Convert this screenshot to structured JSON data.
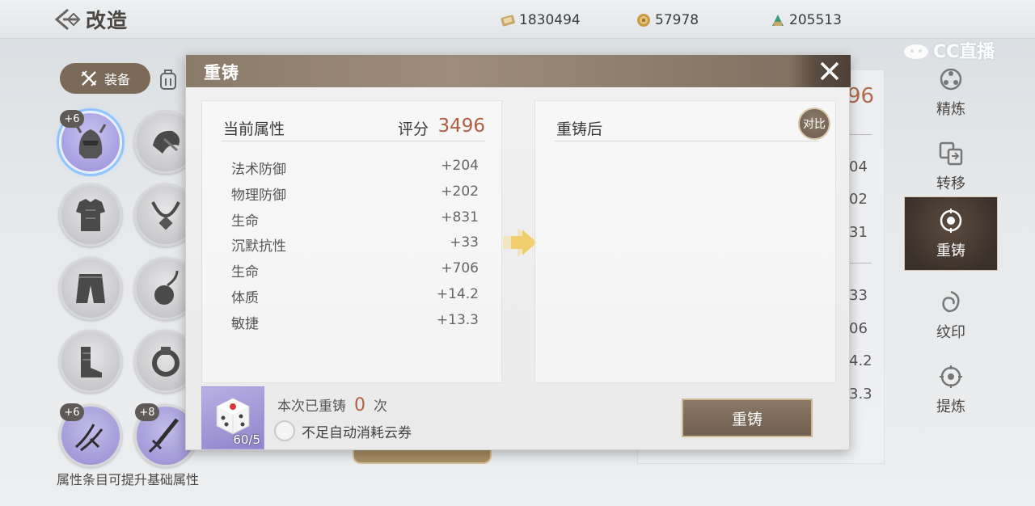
{
  "header": {
    "title": "改造",
    "resources": [
      {
        "icon": "scroll-ticket-icon",
        "value": "1830494"
      },
      {
        "icon": "gold-coin-icon",
        "value": "57978"
      },
      {
        "icon": "jade-currency-icon",
        "value": "205513"
      }
    ],
    "watermark": "CC直播"
  },
  "left": {
    "tab_equip_label": "装备",
    "slots": [
      {
        "name": "helmet",
        "level": "+6",
        "selected": true
      },
      {
        "name": "shoulder"
      },
      {
        "name": "armor"
      },
      {
        "name": "necklace"
      },
      {
        "name": "pants"
      },
      {
        "name": "pendant"
      },
      {
        "name": "boots"
      },
      {
        "name": "ring"
      },
      {
        "name": "weapon-claw",
        "level": "+6"
      },
      {
        "name": "weapon-sword",
        "level": "+8"
      }
    ],
    "hint": "属性条目可提升基础属性"
  },
  "sidebar": {
    "items": [
      {
        "label": "精炼",
        "icon": "refine-icon",
        "active": false
      },
      {
        "label": "转移",
        "icon": "transfer-icon",
        "active": false
      },
      {
        "label": "重铸",
        "icon": "recast-icon",
        "active": true
      },
      {
        "label": "纹印",
        "icon": "seal-icon",
        "active": false
      },
      {
        "label": "提炼",
        "icon": "extract-icon",
        "active": false
      }
    ]
  },
  "background_panel": {
    "score_partial": "96",
    "values_partial": [
      "04",
      "02",
      "31",
      "33",
      "06",
      "4.2",
      "3.3"
    ]
  },
  "modal": {
    "title": "重铸",
    "current": {
      "title": "当前属性",
      "score_label": "评分",
      "score": "3496",
      "attributes": [
        {
          "name": "法术防御",
          "value": "+204"
        },
        {
          "name": "物理防御",
          "value": "+202"
        },
        {
          "name": "生命",
          "value": "+831"
        },
        {
          "name": "沉默抗性",
          "value": "+33"
        },
        {
          "name": "生命",
          "value": "+706"
        },
        {
          "name": "体质",
          "value": "+14.2"
        },
        {
          "name": "敏捷",
          "value": "+13.3"
        }
      ]
    },
    "after": {
      "title": "重铸后",
      "compare_label": "对比"
    },
    "item_count": "60/5",
    "recast_prefix": "本次已重铸",
    "recast_times": "0",
    "recast_suffix": "次",
    "auto_consume_label": "不足自动消耗云券",
    "recast_button": "重铸"
  },
  "colors": {
    "accent": "#b15f42",
    "header_brown": "#8a7a68",
    "selected_purple": "#a79fe0"
  }
}
